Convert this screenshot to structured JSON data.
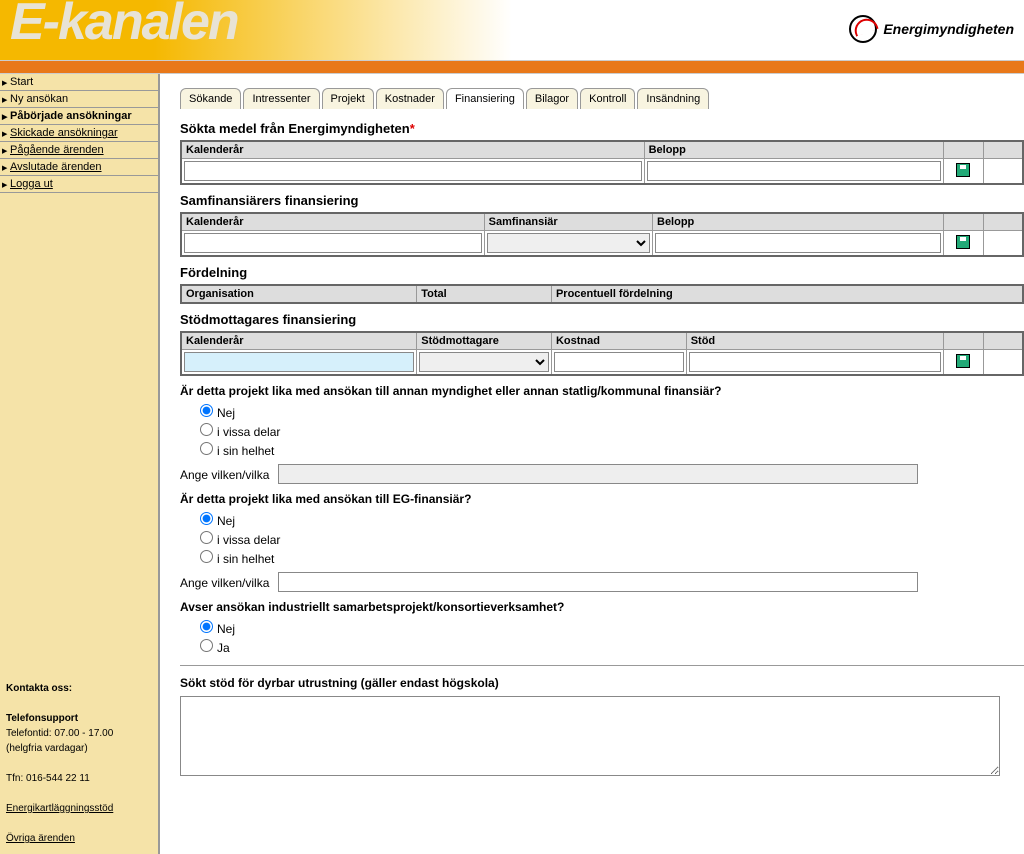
{
  "header": {
    "title": "E-kanalen",
    "logo_text": "Energimyndigheten"
  },
  "nav": [
    {
      "label": "Start",
      "bold": false
    },
    {
      "label": "Ny ansökan",
      "bold": false
    },
    {
      "label": "Påbörjade ansökningar",
      "bold": true
    },
    {
      "label": "Skickade ansökningar",
      "bold": false,
      "underline": true
    },
    {
      "label": "Pågående ärenden",
      "bold": false,
      "underline": true
    },
    {
      "label": "Avslutade ärenden",
      "bold": false,
      "underline": true
    },
    {
      "label": "Logga ut",
      "bold": false,
      "underline": true
    }
  ],
  "contact": {
    "heading": "Kontakta oss:",
    "support": "Telefonsupport",
    "hours": "Telefontid: 07.00 - 17.00",
    "days": "(helgfria vardagar)",
    "phone": "Tfn: 016-544 22 11",
    "link1": "Energikartläggningsstöd",
    "link2": "Övriga ärenden"
  },
  "tabs": [
    "Sökande",
    "Intressenter",
    "Projekt",
    "Kostnader",
    "Finansiering",
    "Bilagor",
    "Kontroll",
    "Insändning"
  ],
  "active_tab": 4,
  "sections": {
    "sokta": {
      "title": "Sökta medel från Energimyndigheten",
      "required": "*",
      "cols": {
        "kalenderar": "Kalenderår",
        "belopp": "Belopp"
      },
      "row": {
        "kalenderar": "",
        "belopp": ""
      }
    },
    "samfin": {
      "title": "Samfinansiärers finansiering",
      "cols": {
        "kalenderar": "Kalenderår",
        "samfinansiar": "Samfinansiär",
        "belopp": "Belopp"
      },
      "row": {
        "kalenderar": "",
        "samfinansiar": "",
        "belopp": ""
      }
    },
    "fordelning": {
      "title": "Fördelning",
      "cols": {
        "organisation": "Organisation",
        "total": "Total",
        "procent": "Procentuell fördelning"
      }
    },
    "stodmott": {
      "title": "Stödmottagares finansiering",
      "cols": {
        "kalenderar": "Kalenderår",
        "stodmottagare": "Stödmottagare",
        "kostnad": "Kostnad",
        "stod": "Stöd"
      },
      "row": {
        "kalenderar": "",
        "stodmottagare": "",
        "kostnad": "",
        "stod": ""
      }
    }
  },
  "questions": {
    "q1": {
      "text": "Är detta projekt lika med ansökan till annan myndighet eller annan statlig/kommunal finansiär?",
      "opts": [
        "Nej",
        "i vissa delar",
        "i sin helhet"
      ],
      "selected": 0,
      "ange_label": "Ange vilken/vilka",
      "ange_value": ""
    },
    "q2": {
      "text": "Är detta projekt lika med ansökan till EG-finansiär?",
      "opts": [
        "Nej",
        "i vissa delar",
        "i sin helhet"
      ],
      "selected": 0,
      "ange_label": "Ange vilken/vilka",
      "ange_value": ""
    },
    "q3": {
      "text": "Avser ansökan industriellt samarbetsprojekt/konsortieverksamhet?",
      "opts": [
        "Nej",
        "Ja"
      ],
      "selected": 0
    },
    "q4": {
      "text": "Sökt stöd för dyrbar utrustning (gäller endast högskola)",
      "value": ""
    }
  }
}
